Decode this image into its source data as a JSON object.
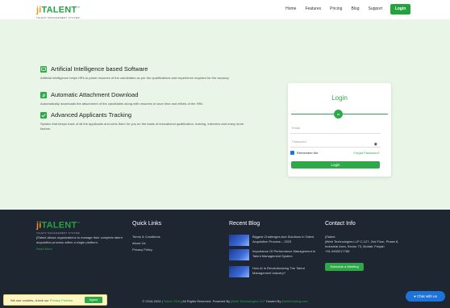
{
  "nav": {
    "logo_prefix": "ji",
    "logo_main": "TALENT",
    "logo_tm": "™",
    "logo_tagline": "TALENT MANAGEMENT SYSTEM",
    "menu": [
      "Home",
      "Features",
      "Pricing",
      "Blog",
      "Support"
    ],
    "login_label": "Login"
  },
  "features": [
    {
      "title": "Artificial Intelligence based Software",
      "desc": "Artificial intelligence helps HRs to parse resumes of the candidates as per the qualifications and experience required for the vacancy",
      "icon": "monitor-icon"
    },
    {
      "title": "Automatic Attachment Download",
      "desc": "Automatically downloads the attachment of the candidates along with resumes to save time and efforts of the HRs",
      "icon": "paperclip-icon"
    },
    {
      "title": "Advanced Applicants Tracking",
      "desc": "System that keeps track of all the applicants and sorts them for you on the basis of educational qualification, training, interview and many more factors.",
      "icon": "check-icon"
    }
  ],
  "login_card": {
    "title": "Login",
    "or_label": "or",
    "email_placeholder": "Email",
    "password_placeholder": "Password",
    "remember_label": "Remember Me",
    "forgot_label": "Forgot Password?",
    "button_label": "Login"
  },
  "footer": {
    "about": "jiTalent allows organizations to manage their complete talent acquisition process within a single platform.",
    "read_more": "Read More",
    "quick_links_title": "Quick Links",
    "quick_links": [
      "Terms & Conditions",
      "About Us",
      "Privacy Policy"
    ],
    "blog_title": "Recent Blog",
    "blogs": [
      "Biggest Challenges And Solutions In Talent Acquisition Process – 2023",
      "Importance Of Performance Management In Talent Management System",
      "How AI Is Revolutionizing The Talent Management Industry?"
    ],
    "contact_title": "Contact Info",
    "contact_lines": [
      "jiTalent",
      "jiWeb Technologies LLP C-127, 2nd Floor, Phase 8,",
      "Industrial Area, Sector 73, Mohali, Punjab",
      "+91-9463217788"
    ],
    "schedule_label": "Schedule a Meeting",
    "copyright_prefix": "© 2016-2024 |",
    "copyright_brand": "Talent-TMS",
    "copyright_mid": "| All Rights Reserved. Powered By",
    "copyright_powered": "jiWeb Technologies LLP",
    "copyright_hosted": "Hosted By",
    "copyright_host": "jiWebHosting.com"
  },
  "cookie": {
    "text": "We use cookies, check our",
    "link": "Privacy Policies.",
    "button": "Agree"
  },
  "chat": {
    "label": "Chat with us"
  },
  "colors": {
    "brand_green": "#2fa84a",
    "logo_orange": "#e39a1e",
    "footer_bg": "#1e2632",
    "hero_bg": "#e9f6e7"
  }
}
